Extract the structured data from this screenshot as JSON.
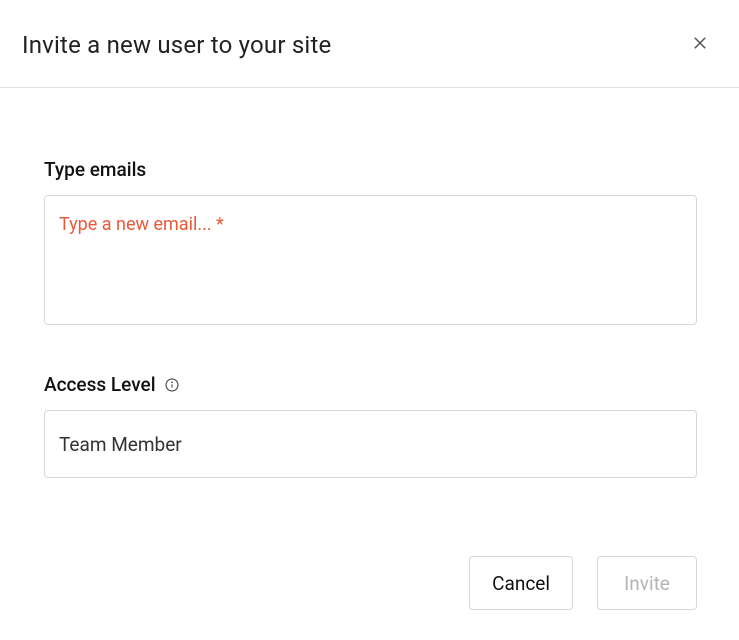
{
  "header": {
    "title": "Invite a new user to your site"
  },
  "form": {
    "emails": {
      "label": "Type emails",
      "placeholder": "Type a new email... *",
      "value": ""
    },
    "access_level": {
      "label": "Access Level",
      "value": "Team Member"
    }
  },
  "footer": {
    "cancel_label": "Cancel",
    "invite_label": "Invite"
  }
}
